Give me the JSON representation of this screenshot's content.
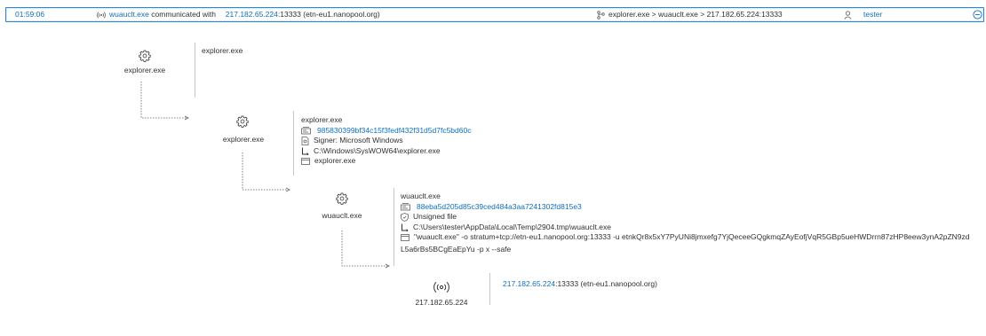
{
  "event": {
    "time": "01:59:06",
    "process": "wuauclt.exe",
    "action_text": "communicated with",
    "ip": "217.182.65.224",
    "port_host": ":13333 (etn-eu1.nanopool.org)",
    "path_text": "explorer.exe > wuauclt.exe > 217.182.65.224:13333",
    "user": "tester"
  },
  "tree": {
    "root": {
      "label": "explorer.exe",
      "detail_name": "explorer.exe"
    },
    "child": {
      "label": "explorer.exe",
      "name": "explorer.exe",
      "hash": "985830399bf34c15f3fedf432f31d5d7fc5bd60c",
      "signer": "Signer: Microsoft Windows",
      "path": "C:\\Windows\\SysWOW64\\explorer.exe",
      "cmdline": "explorer.exe"
    },
    "grandchild": {
      "label": "wuauclt.exe",
      "name": "wuauclt.exe",
      "hash": "88eba5d205d85c39ced484a3aa7241302fd815e3",
      "signer": "Unsigned file",
      "path": "C:\\Users\\tester\\AppData\\Local\\Temp\\2904.tmp\\wuauclt.exe",
      "cmdline_line1": "\"wuauclt.exe\" -o stratum+tcp://etn-eu1.nanopool.org:13333 -u etnkQr8x5xY7PyUNi8jmxefg7YjQeceeGQgkmqZAyEofjVqR5GBp5ueHWDrrn87zHP8eew3ynA2pZN9zd",
      "cmdline_line2": "L5a6rBs5BCgEaEpYu -p x --safe"
    },
    "network": {
      "label": "217.182.65.224",
      "ip": "217.182.65.224",
      "port_host": ":13333 (etn-eu1.nanopool.org)"
    }
  },
  "icons": {
    "network": "network-broadcast-icon",
    "path": "process-tree-icon",
    "user": "user-icon",
    "collapse": "collapse-icon",
    "process": "gear-icon",
    "hash": "hash-icon",
    "signer": "certificate-icon",
    "folder": "folder-path-icon",
    "cmd": "command-line-icon",
    "shield": "shield-icon"
  }
}
